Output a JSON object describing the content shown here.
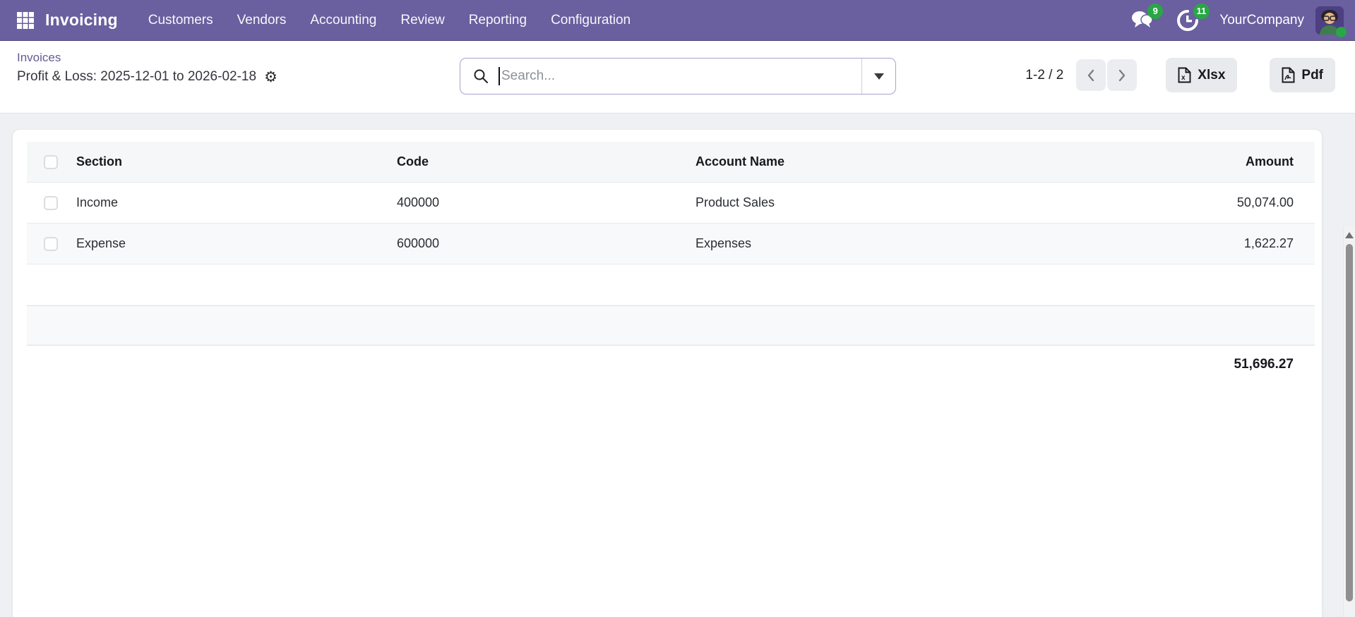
{
  "topbar": {
    "app_name": "Invoicing",
    "menus": [
      "Customers",
      "Vendors",
      "Accounting",
      "Review",
      "Reporting",
      "Configuration"
    ],
    "messages_badge": "9",
    "activities_badge": "11",
    "company": "YourCompany",
    "colors": {
      "bar": "#6A5F9F",
      "badge_green": "#28a745",
      "link_purple": "#655a96"
    }
  },
  "breadcrumb": {
    "parent": "Invoices",
    "title": "Profit & Loss: 2025-12-01 to 2026-02-18"
  },
  "search": {
    "placeholder": "Search...",
    "value": ""
  },
  "pager": {
    "range": "1-2 / 2"
  },
  "export": {
    "xlsx_label": "Xlsx",
    "pdf_label": "Pdf"
  },
  "table": {
    "columns": {
      "section": "Section",
      "code": "Code",
      "account": "Account Name",
      "amount": "Amount"
    },
    "rows": [
      {
        "section": "Income",
        "code": "400000",
        "account": "Product Sales",
        "amount": "50,074.00"
      },
      {
        "section": "Expense",
        "code": "600000",
        "account": "Expenses",
        "amount": "1,622.27"
      }
    ],
    "total": "51,696.27"
  }
}
